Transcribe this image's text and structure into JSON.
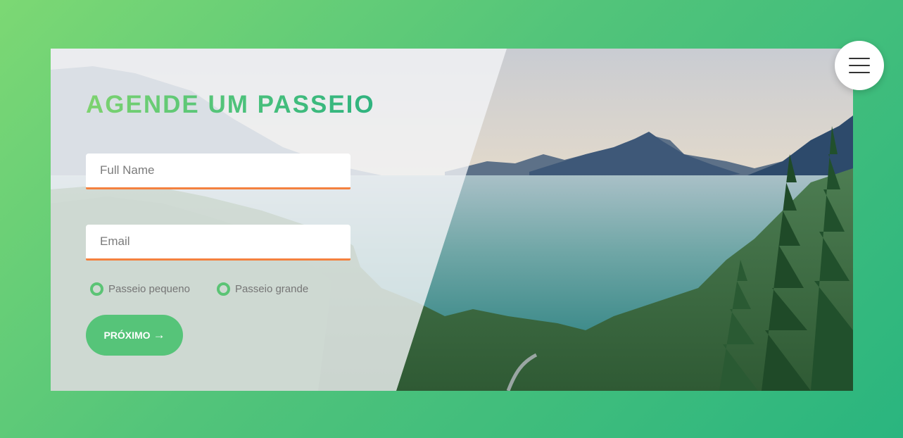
{
  "form": {
    "title": "AGENDE UM PASSEIO",
    "name_placeholder": "Full Name",
    "email_placeholder": "Email",
    "options": [
      {
        "label": "Passeio pequeno"
      },
      {
        "label": "Passeio grande"
      }
    ],
    "next_label": "PRÓXIMO",
    "next_arrow": "→"
  },
  "menu": {
    "icon": "hamburger-menu-icon"
  },
  "colors": {
    "background_gradient_start": "#7cd874",
    "background_gradient_end": "#2ab57f",
    "accent_green": "#56c479",
    "input_underline_orange": "#f4813f"
  }
}
